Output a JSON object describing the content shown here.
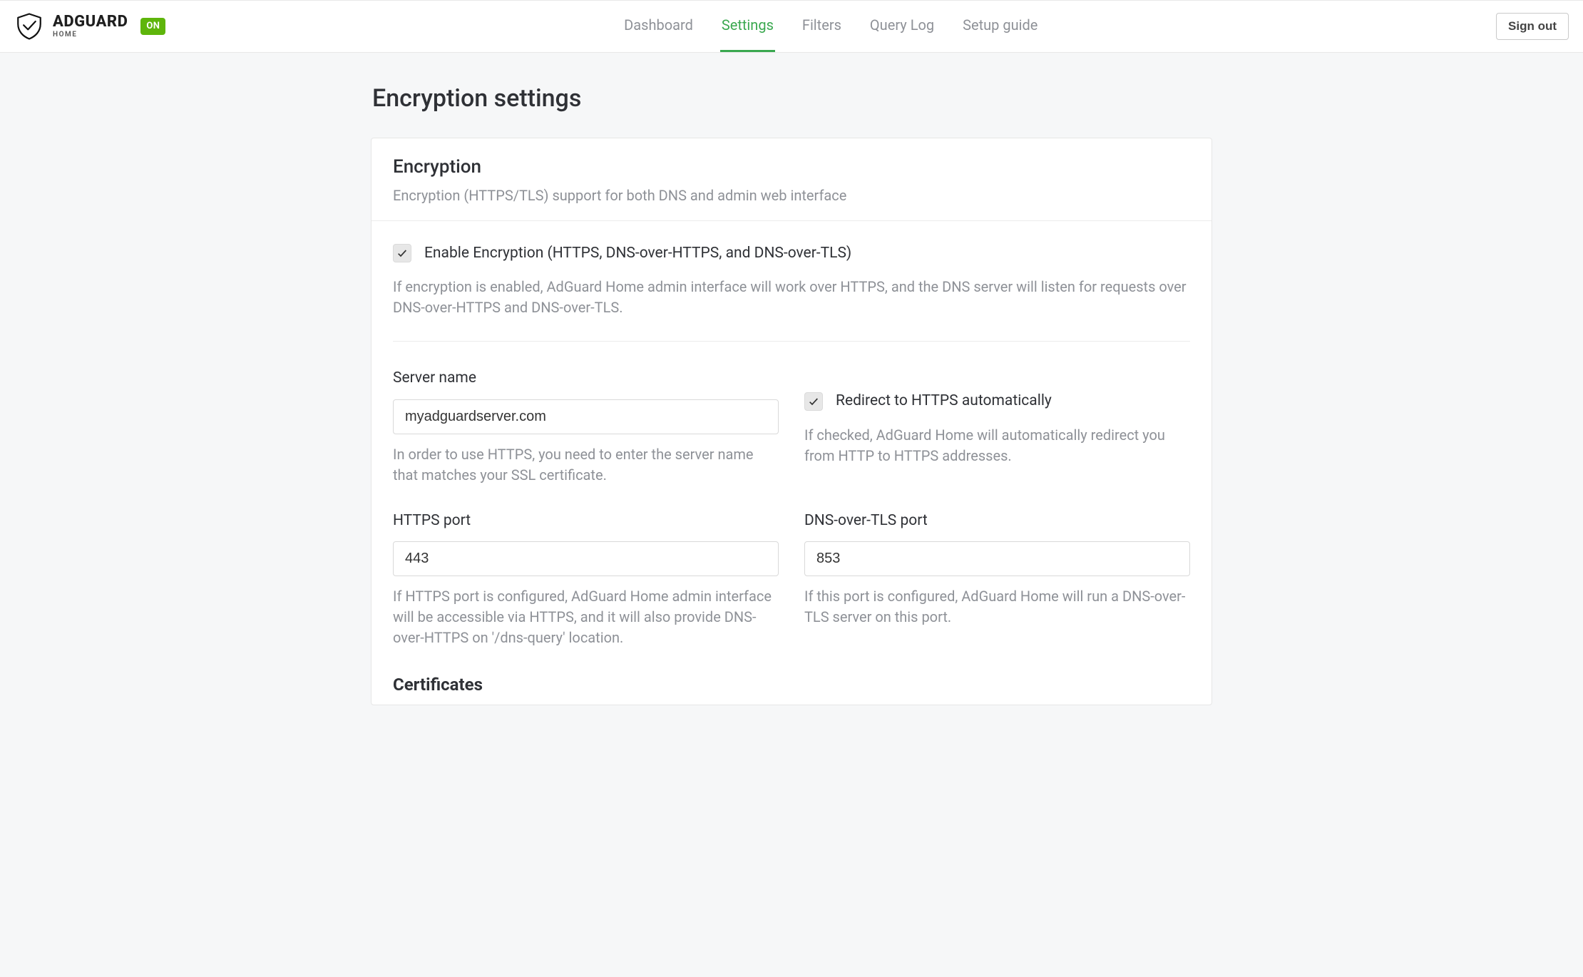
{
  "brand": {
    "name": "ADGUARD",
    "sub": "HOME",
    "status": "ON"
  },
  "nav": {
    "items": [
      {
        "label": "Dashboard"
      },
      {
        "label": "Settings"
      },
      {
        "label": "Filters"
      },
      {
        "label": "Query Log"
      },
      {
        "label": "Setup guide"
      }
    ],
    "active_index": 1
  },
  "signout_label": "Sign out",
  "page_title": "Encryption settings",
  "card": {
    "title": "Encryption",
    "subtitle": "Encryption (HTTPS/TLS) support for both DNS and admin web interface"
  },
  "enable": {
    "label": "Enable Encryption (HTTPS, DNS-over-HTTPS, and DNS-over-TLS)",
    "help": "If encryption is enabled, AdGuard Home admin interface will work over HTTPS, and the DNS server will listen for requests over DNS-over-HTTPS and DNS-over-TLS."
  },
  "server_name": {
    "label": "Server name",
    "value": "myadguardserver.com",
    "help": "In order to use HTTPS, you need to enter the server name that matches your SSL certificate."
  },
  "redirect": {
    "label": "Redirect to HTTPS automatically",
    "help": "If checked, AdGuard Home will automatically redirect you from HTTP to HTTPS addresses."
  },
  "https_port": {
    "label": "HTTPS port",
    "value": "443",
    "help": "If HTTPS port is configured, AdGuard Home admin interface will be accessible via HTTPS, and it will also provide DNS-over-HTTPS on '/dns-query' location."
  },
  "tls_port": {
    "label": "DNS-over-TLS port",
    "value": "853",
    "help": "If this port is configured, AdGuard Home will run a DNS-over-TLS server on this port."
  },
  "certificates_heading": "Certificates"
}
